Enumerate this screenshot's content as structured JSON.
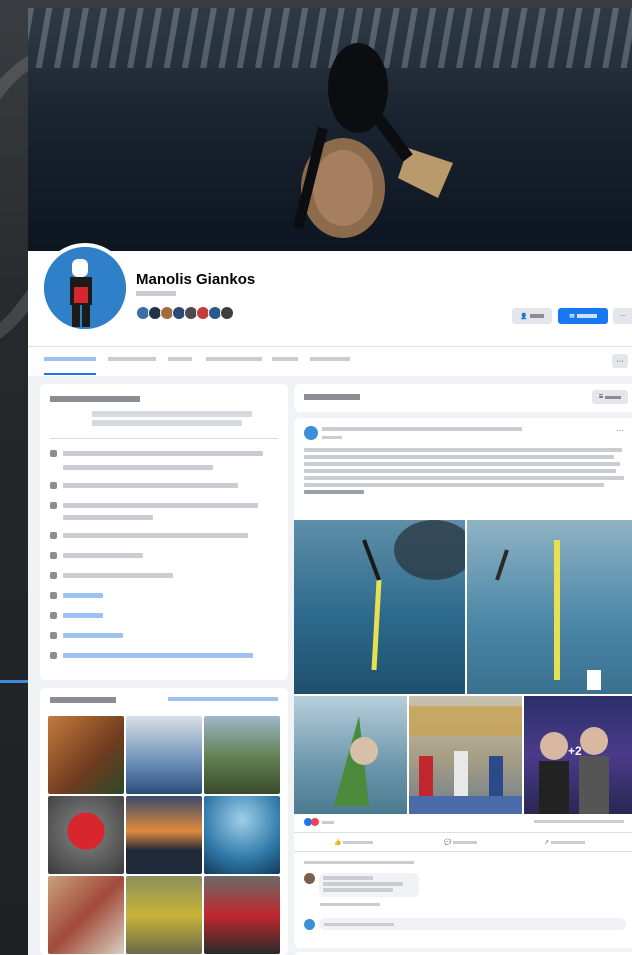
{
  "profile": {
    "name": "Manolis Giankos"
  },
  "header": {
    "more_label": "···"
  },
  "tabs": {
    "more_label": "···"
  },
  "post": {
    "dots": "···",
    "extra_photos_badge": "+2"
  },
  "colors": {
    "accent": "#1877f2",
    "page_bg": "#f0f2f5",
    "card_bg": "#ffffff",
    "link": "#1877f2"
  }
}
